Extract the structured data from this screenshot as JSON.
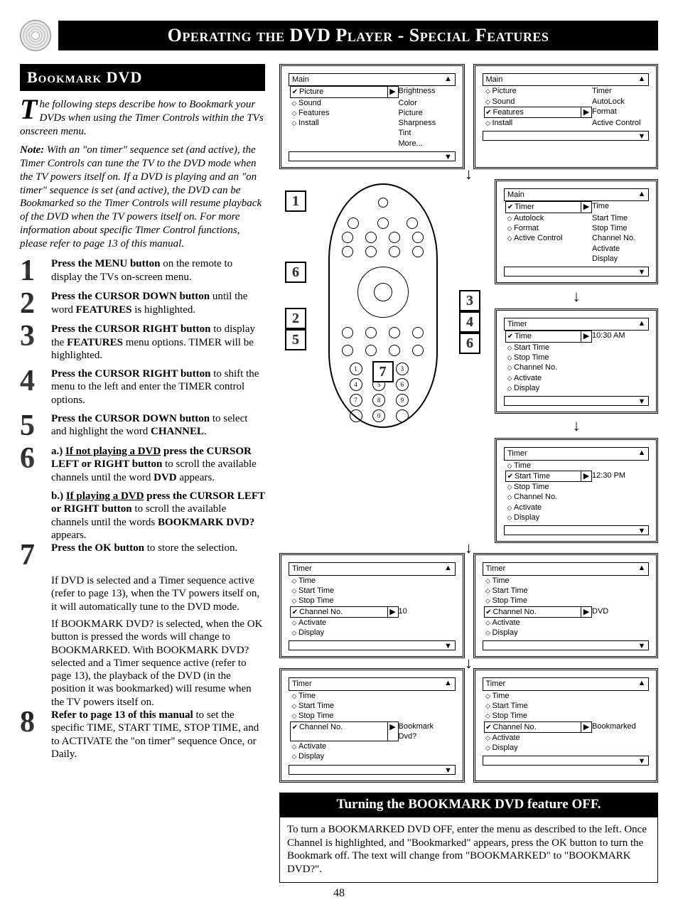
{
  "header": {
    "title_html": "Operating the DVD Player - Special Features"
  },
  "subheader": {
    "title": "Bookmark DVD"
  },
  "intro": "he following steps describe how to Bookmark your DVDs when using the Timer Controls within the TVs onscreen menu.",
  "dropcap": "T",
  "note_label": "Note:",
  "note": "With an \"on timer\" sequence set (and active), the Timer Controls can tune the TV to the DVD mode when the TV powers itself on. If a DVD is playing and an \"on timer\" sequence is set (and active), the DVD can be Bookmarked so the Timer Controls will resume playback of the DVD when the TV powers itself on. For more information about specific Timer Control functions, please refer to page 13 of this manual.",
  "steps": [
    {
      "n": "1",
      "html": "<strong>Press the MENU button</strong> on the remote to display the TVs on-screen menu."
    },
    {
      "n": "2",
      "html": "<strong>Press the CURSOR DOWN button</strong> until the word <strong>FEATURES</strong> is highlighted."
    },
    {
      "n": "3",
      "html": "<strong>Press the CURSOR RIGHT button</strong> to display the <strong>FEATURES</strong> menu options. TIMER will be highlighted."
    },
    {
      "n": "4",
      "html": "<strong>Press the CURSOR RIGHT button</strong> to shift the menu to the left and enter the TIMER control options."
    },
    {
      "n": "5",
      "html": "<strong>Press the CURSOR DOWN button</strong> to select and highlight the word <strong>CHANNEL</strong>."
    },
    {
      "n": "6",
      "html": "<strong>a.) <u>If not playing a DVD</u> press the CURSOR LEFT or RIGHT button</strong> to scroll the available channels until the word <strong>DVD</strong> appears."
    },
    {
      "n": "",
      "indent": true,
      "html": "<strong>b.) <u>If playing a DVD</u> press the CURSOR LEFT or RIGHT button</strong> to scroll the available channels until the words <strong>BOOKMARK DVD?</strong> appears."
    },
    {
      "n": "7",
      "html": "<strong>Press the OK button</strong> to store the selection."
    },
    {
      "n": "",
      "indent": true,
      "html": "If DVD is selected and a Timer sequence active (refer to page 13), when the TV powers itself on, it will automatically tune to the DVD mode."
    },
    {
      "n": "",
      "indent": true,
      "html": "If BOOKMARK DVD? is selected, when the OK button is pressed the words will change to BOOKMARKED. With BOOKMARK DVD? selected and a Timer sequence active (refer to page 13), the playback of the DVD (in the position it was bookmarked) will resume when the TV powers itself on."
    },
    {
      "n": "8",
      "html": "<strong>Refer to page 13 of this manual</strong> to set the specific TIME, START TIME, STOP TIME, and to ACTIVATE the \"on timer\" sequence Once, or Daily."
    }
  ],
  "remote_callouts_left": [
    "1",
    "6",
    "2",
    "5"
  ],
  "remote_callouts_right": [
    "3",
    "4",
    "6"
  ],
  "remote_center": "7",
  "menus": {
    "main_picture": {
      "hdr": "Main",
      "rows": [
        {
          "sel": true,
          "a": "Picture",
          "b": "Brightness"
        },
        {
          "a": "Sound",
          "b": "Color"
        },
        {
          "a": "Features",
          "b": "Picture"
        },
        {
          "a": "Install",
          "b": "Sharpness"
        },
        {
          "a": "",
          "b": "Tint"
        },
        {
          "a": "",
          "b": "More..."
        }
      ]
    },
    "main_features": {
      "hdr": "Main",
      "rows": [
        {
          "a": "Picture",
          "b": "Timer"
        },
        {
          "a": "Sound",
          "b": "AutoLock"
        },
        {
          "sel": true,
          "a": "Features",
          "b": "Format"
        },
        {
          "a": "Install",
          "b": "Active Control"
        }
      ]
    },
    "main_timer": {
      "hdr": "Main",
      "rows": [
        {
          "sel": true,
          "a": "Timer",
          "b": "Time"
        },
        {
          "a": "Autolock",
          "b": "Start Time"
        },
        {
          "a": "Format",
          "b": "Stop Time"
        },
        {
          "a": "Active Control",
          "b": "Channel No."
        },
        {
          "a": "",
          "b": "Activate"
        },
        {
          "a": "",
          "b": "Display"
        }
      ]
    },
    "timer_time": {
      "hdr": "Timer",
      "rows": [
        {
          "sel": true,
          "a": "Time",
          "b": "10:30 AM"
        },
        {
          "a": "Start Time",
          "b": ""
        },
        {
          "a": "Stop Time",
          "b": ""
        },
        {
          "a": "Channel No.",
          "b": ""
        },
        {
          "a": "Activate",
          "b": ""
        },
        {
          "a": "Display",
          "b": ""
        }
      ]
    },
    "timer_start": {
      "hdr": "Timer",
      "rows": [
        {
          "a": "Time",
          "b": ""
        },
        {
          "sel": true,
          "a": "Start Time",
          "b": "12:30 PM"
        },
        {
          "a": "Stop Time",
          "b": ""
        },
        {
          "a": "Channel No.",
          "b": ""
        },
        {
          "a": "Activate",
          "b": ""
        },
        {
          "a": "Display",
          "b": ""
        }
      ]
    },
    "timer_chan10": {
      "hdr": "Timer",
      "rows": [
        {
          "a": "Time",
          "b": ""
        },
        {
          "a": "Start Time",
          "b": ""
        },
        {
          "a": "Stop Time",
          "b": ""
        },
        {
          "sel": true,
          "a": "Channel No.",
          "b": "10"
        },
        {
          "a": "Activate",
          "b": ""
        },
        {
          "a": "Display",
          "b": ""
        }
      ]
    },
    "timer_chandvd": {
      "hdr": "Timer",
      "rows": [
        {
          "a": "Time",
          "b": ""
        },
        {
          "a": "Start Time",
          "b": ""
        },
        {
          "a": "Stop Time",
          "b": ""
        },
        {
          "sel": true,
          "a": "Channel No.",
          "b": "DVD"
        },
        {
          "a": "Activate",
          "b": ""
        },
        {
          "a": "Display",
          "b": ""
        }
      ]
    },
    "timer_bmq": {
      "hdr": "Timer",
      "rows": [
        {
          "a": "Time",
          "b": ""
        },
        {
          "a": "Start Time",
          "b": ""
        },
        {
          "a": "Stop Time",
          "b": ""
        },
        {
          "sel": true,
          "a": "Channel No.",
          "b": "Bookmark Dvd?"
        },
        {
          "a": "Activate",
          "b": ""
        },
        {
          "a": "Display",
          "b": ""
        }
      ]
    },
    "timer_bmd": {
      "hdr": "Timer",
      "rows": [
        {
          "a": "Time",
          "b": ""
        },
        {
          "a": "Start Time",
          "b": ""
        },
        {
          "a": "Stop Time",
          "b": ""
        },
        {
          "sel": true,
          "a": "Channel No.",
          "b": "Bookmarked"
        },
        {
          "a": "Activate",
          "b": ""
        },
        {
          "a": "Display",
          "b": ""
        }
      ]
    }
  },
  "turn_off": {
    "title": "Turning the BOOKMARK DVD feature OFF.",
    "body": "To turn a BOOKMARKED DVD OFF, enter the menu as described to the left. Once Channel is highlighted, and \"Bookmarked\" appears, press the OK button to turn the Bookmark off. The text will change from \"BOOKMARKED\" to \"BOOKMARK DVD?\"."
  },
  "page_number": "48"
}
